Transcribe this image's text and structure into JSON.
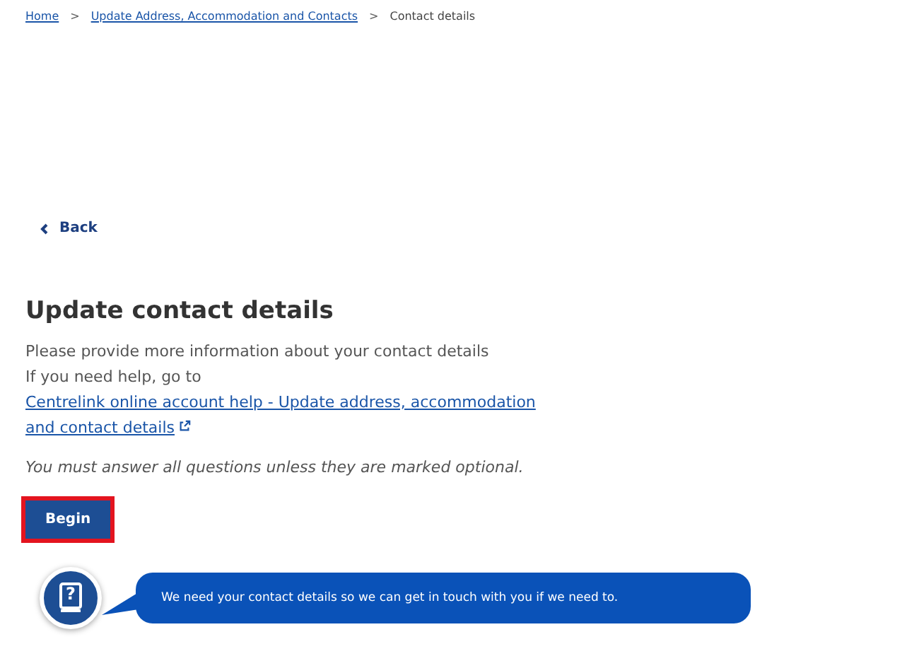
{
  "breadcrumbs": [
    {
      "label": "Home",
      "link": true
    },
    {
      "label": "Update Address, Accommodation and Contacts",
      "link": true
    },
    {
      "label": "Contact details",
      "link": false
    }
  ],
  "breadcrumb_separator": ">",
  "back_link": "Back",
  "heading": "Update contact details",
  "intro": "Please provide more information about your contact details",
  "help_prefix": "If you need help, go to",
  "help_link_lines": [
    "Centrelink online account help - Update address, accommodation",
    "and contact details"
  ],
  "note": "You must answer all questions unless they are marked optional.",
  "begin_button": {
    "label": "Begin",
    "focused": true
  },
  "helper": {
    "glyph": "?",
    "message": "We need your contact details so we can get in touch with you if we need to."
  }
}
